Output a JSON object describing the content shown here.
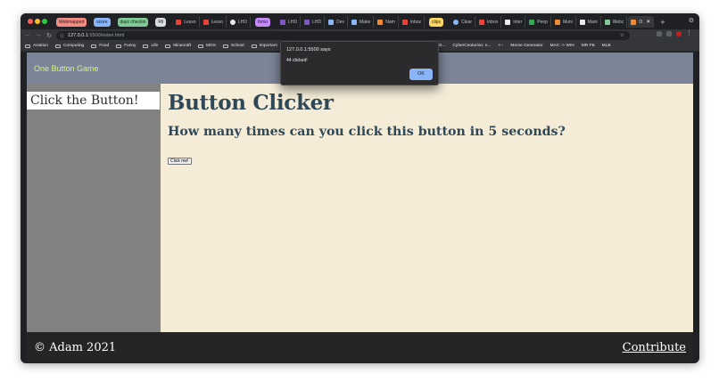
{
  "browser": {
    "tab_groups": [
      {
        "label": "Webmapped",
        "color": "#f28b82"
      },
      {
        "label": "score",
        "color": "#8ab4f8"
      },
      {
        "label": "days checkin",
        "color": "#81c995"
      },
      {
        "label": "Ril",
        "color": "#dadce0"
      },
      {
        "label": "fomo",
        "color": "#c58af9"
      },
      {
        "label": "clips",
        "color": "#fdd663"
      }
    ],
    "tabs": [
      {
        "label": "Lesso",
        "icon": "google-icon"
      },
      {
        "label": "Lesso",
        "icon": "google-icon"
      },
      {
        "label": "LHD",
        "icon": "github-icon"
      },
      {
        "label": "LHD",
        "icon": "purple-square-icon"
      },
      {
        "label": "LHD",
        "icon": "purple-square-icon"
      },
      {
        "label": "Dev",
        "icon": "d-icon"
      },
      {
        "label": "Make",
        "icon": "d-icon"
      },
      {
        "label": "Nam",
        "icon": "orange-square-icon"
      },
      {
        "label": "Inbox",
        "icon": "gmail-icon"
      },
      {
        "label": "Clear",
        "icon": "cloud-icon"
      },
      {
        "label": "Inbox",
        "icon": "gmail-icon"
      },
      {
        "label": "Inter",
        "icon": "white-square-icon"
      },
      {
        "label": "Peop",
        "icon": "green-square-icon"
      },
      {
        "label": "Muni",
        "icon": "orange-triangle-icon"
      },
      {
        "label": "Mani",
        "icon": "white-square-icon"
      },
      {
        "label": "Webc",
        "icon": "w-icon"
      },
      {
        "label": "O",
        "icon": "orange-triangle-icon",
        "active": true
      }
    ],
    "url_host": "127.0.0.1",
    "url_path": ":5500/index.html",
    "bookmarks": {
      "left": [
        "Aviation",
        "Computing",
        "Food",
        "Funny",
        "Life",
        "Minecraft",
        "MOS",
        "School",
        "Important"
      ],
      "right": [
        "Hack Day: B...",
        "CyberCenturion: n...",
        "<--",
        "Meme Generator",
        "MAC -> WIN",
        "MR FB",
        "MLB"
      ]
    }
  },
  "site": {
    "header_title": "One Button Game",
    "sidebar_item": "Click the Button!",
    "heading": "Button Clicker",
    "subheading": "How many times can you click this button in 5 seconds?",
    "button_label": "Click me!",
    "copyright": "© Adam 2021",
    "contribute": "Contribute"
  },
  "alert": {
    "origin": "127.0.0.1:5500 says",
    "message": "44 clicked!",
    "ok_label": "OK"
  }
}
